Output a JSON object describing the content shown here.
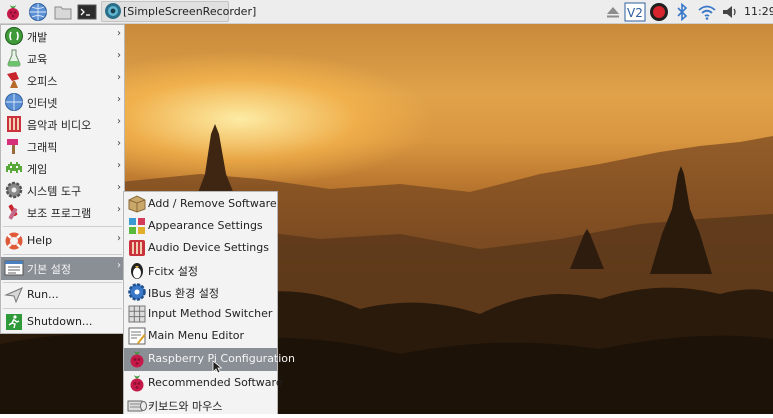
{
  "taskbar": {
    "launchers": [
      "raspberry-icon",
      "web-browser-icon",
      "file-manager-icon",
      "terminal-icon"
    ],
    "task_label": "[SimpleScreenRecorder]",
    "tray": [
      "eject-icon",
      "vnc-icon",
      "record-icon",
      "bluetooth-icon",
      "wifi-icon",
      "volume-icon"
    ],
    "vnc_label": "V2",
    "clock": "11:29"
  },
  "main_menu": {
    "items": [
      {
        "label": "개발",
        "icon": "programming-icon",
        "submenu": true
      },
      {
        "label": "교육",
        "icon": "education-icon",
        "submenu": true
      },
      {
        "label": "오피스",
        "icon": "office-icon",
        "submenu": true
      },
      {
        "label": "인터넷",
        "icon": "internet-icon",
        "submenu": true
      },
      {
        "label": "음악과 비디오",
        "icon": "sound-video-icon",
        "submenu": true
      },
      {
        "label": "그래픽",
        "icon": "graphics-icon",
        "submenu": true
      },
      {
        "label": "게임",
        "icon": "games-icon",
        "submenu": true
      },
      {
        "label": "시스템 도구",
        "icon": "system-tools-icon",
        "submenu": true
      },
      {
        "label": "보조 프로그램",
        "icon": "accessories-icon",
        "submenu": true
      },
      {
        "label": "Help",
        "icon": "help-icon",
        "submenu": true
      },
      {
        "label": "기본 설정",
        "icon": "preferences-icon",
        "submenu": true
      },
      {
        "label": "Run...",
        "icon": "run-icon",
        "submenu": false
      },
      {
        "label": "Shutdown...",
        "icon": "shutdown-icon",
        "submenu": false
      }
    ],
    "selected": "기본 설정"
  },
  "sub_menu": {
    "items": [
      {
        "label": "Add / Remove Software",
        "icon": "package-icon"
      },
      {
        "label": "Appearance Settings",
        "icon": "appearance-icon"
      },
      {
        "label": "Audio Device Settings",
        "icon": "audio-settings-icon"
      },
      {
        "label": "Fcitx 설정",
        "icon": "penguin-icon"
      },
      {
        "label": "IBus 환경 설정",
        "icon": "ibus-gear-icon"
      },
      {
        "label": "Input Method Switcher",
        "icon": "keyboard-grid-icon"
      },
      {
        "label": "Main Menu Editor",
        "icon": "menu-editor-icon"
      },
      {
        "label": "Raspberry Pi Configuration",
        "icon": "raspberry-config-icon"
      },
      {
        "label": "Recommended Software",
        "icon": "raspberry-recommended-icon"
      },
      {
        "label": "키보드와 마우스",
        "icon": "keyboard-mouse-icon"
      }
    ],
    "selected": "Raspberry Pi Configuration"
  }
}
